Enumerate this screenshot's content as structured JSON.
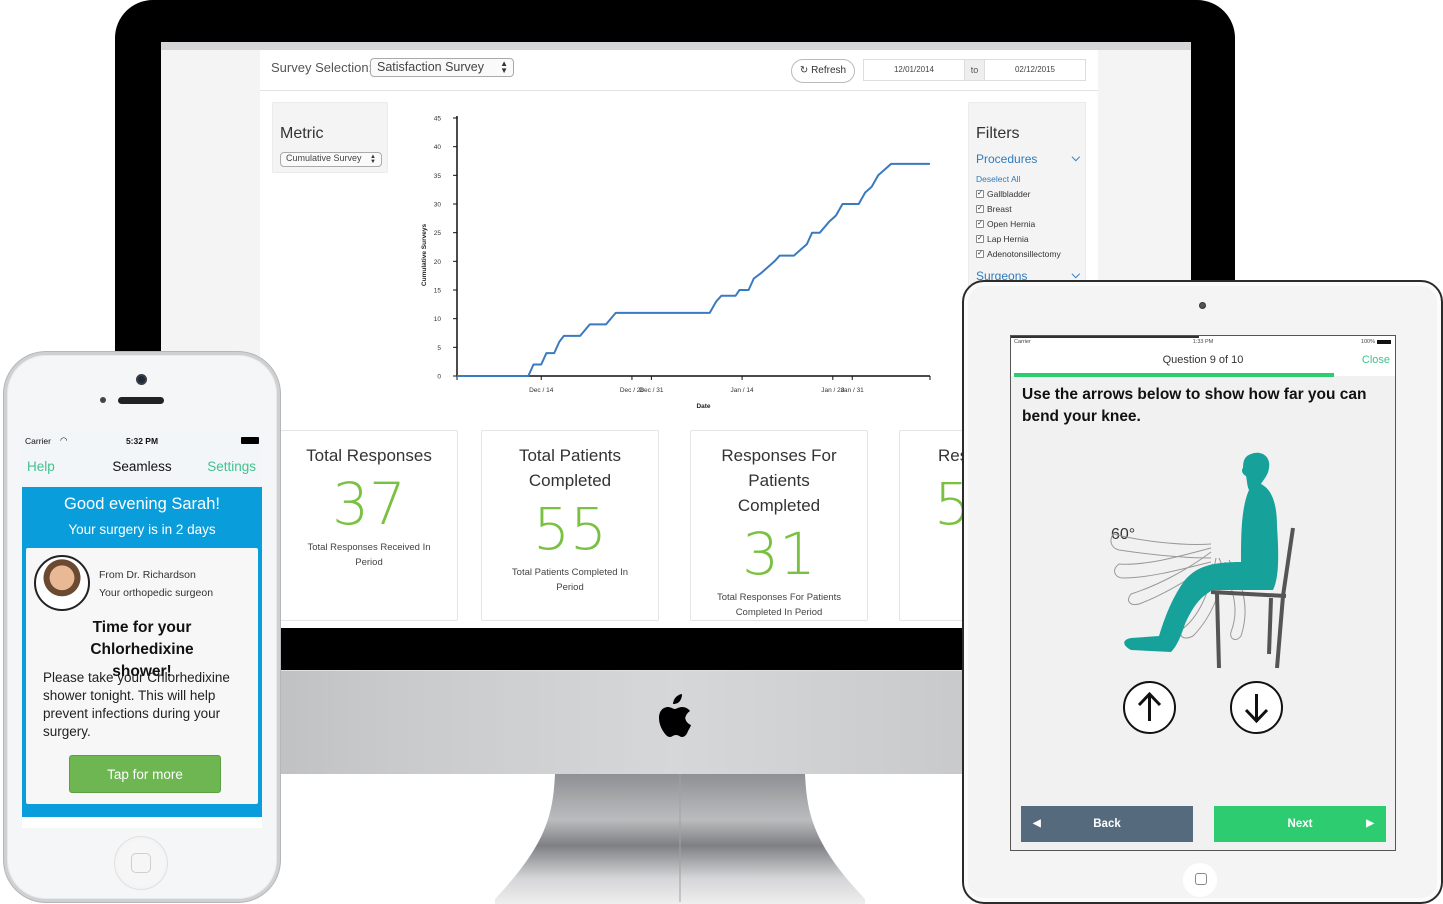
{
  "dashboard": {
    "survey_selection_label": "Survey Selection:",
    "survey_selection_value": "Satisfaction Survey",
    "refresh_label": "Refresh",
    "date_from": "12/01/2014",
    "date_to_label": "to",
    "date_to": "02/12/2015",
    "metric": {
      "title": "Metric",
      "value": "Cumulative Survey"
    },
    "filters": {
      "title": "Filters",
      "procedures_label": "Procedures",
      "deselect_all": "Deselect All",
      "procedures": [
        {
          "label": "Gallbladder",
          "checked": true
        },
        {
          "label": "Breast",
          "checked": true
        },
        {
          "label": "Open Hernia",
          "checked": true
        },
        {
          "label": "Lap Hernia",
          "checked": true
        },
        {
          "label": "Adenotonsillectomy",
          "checked": true
        }
      ],
      "surgeons_label": "Surgeons"
    },
    "cards": [
      {
        "title": "Total Responses",
        "value": "37",
        "subtitle": "Total Responses Received In Period"
      },
      {
        "title": "Total Patients Completed",
        "value": "55",
        "subtitle": "Total Patients Completed In Period"
      },
      {
        "title": "Responses For Patients Completed",
        "value": "31",
        "subtitle": "Total Responses For Patients Completed In Period"
      },
      {
        "title": "Res",
        "value": "5",
        "subtitle": ""
      }
    ],
    "accent_color": "#7ac142",
    "link_color": "#2f7bbd"
  },
  "chart_data": {
    "type": "line",
    "title": "",
    "xlabel": "Date",
    "ylabel": "Cumulative Surveys",
    "ylim": [
      0,
      45
    ],
    "yticks": [
      0,
      5,
      10,
      15,
      20,
      25,
      30,
      35,
      40,
      45
    ],
    "xlim_days": [
      0,
      73
    ],
    "xtick_labels": [
      {
        "day": 13,
        "label": "Dec / 14"
      },
      {
        "day": 27,
        "label": "Dec / 28"
      },
      {
        "day": 30,
        "label": "Dec / 31"
      },
      {
        "day": 44,
        "label": "Jan / 14"
      },
      {
        "day": 58,
        "label": "Jan / 28"
      },
      {
        "day": 61,
        "label": "Jan / 31"
      }
    ],
    "x_origin": "2014-12-01",
    "series": [
      {
        "name": "Cumulative Surveys",
        "color": "#3a7abf",
        "points": [
          [
            0,
            0
          ],
          [
            11,
            0
          ],
          [
            11.8,
            2
          ],
          [
            13,
            2
          ],
          [
            13.8,
            4
          ],
          [
            15,
            4
          ],
          [
            15.8,
            6
          ],
          [
            16.5,
            7
          ],
          [
            19,
            7
          ],
          [
            20.5,
            9
          ],
          [
            23,
            9
          ],
          [
            24.5,
            11
          ],
          [
            39,
            11
          ],
          [
            40,
            13
          ],
          [
            40.8,
            14
          ],
          [
            43,
            14
          ],
          [
            43.6,
            15
          ],
          [
            45,
            15
          ],
          [
            45.8,
            17
          ],
          [
            47,
            18
          ],
          [
            49,
            20
          ],
          [
            49.8,
            21
          ],
          [
            52,
            21
          ],
          [
            53,
            22
          ],
          [
            54,
            23
          ],
          [
            54.8,
            25
          ],
          [
            56,
            25
          ],
          [
            57.5,
            27
          ],
          [
            58.5,
            28
          ],
          [
            59.5,
            30
          ],
          [
            62,
            30
          ],
          [
            63,
            32
          ],
          [
            64,
            33
          ],
          [
            65,
            35
          ],
          [
            66,
            36
          ],
          [
            67,
            37
          ],
          [
            73,
            37
          ]
        ]
      }
    ],
    "grid": false,
    "legend": "none"
  },
  "phone": {
    "carrier": "Carrier",
    "time": "5:32 PM",
    "nav_left": "Help",
    "nav_title": "Seamless",
    "nav_right": "Settings",
    "greeting": "Good evening Sarah!",
    "surgery_countdown": "Your surgery is in 2 days",
    "from_line": "From Dr. Richardson",
    "role_line": "Your orthopedic surgeon",
    "heading": "Time for your Chlorhedixine shower!",
    "body": "Please take your Chlorhedixine shower tonight. This will help prevent infections during your surgery.",
    "button_label": "Tap for more",
    "brand_blue": "#0a9ddb",
    "button_green": "#6db651"
  },
  "tablet": {
    "carrier": "Carrier",
    "time": "1:33 PM",
    "battery": "100%",
    "question_counter": "Question 9 of 10",
    "close_label": "Close",
    "progress": 0.9,
    "question_text": "Use the arrows below  to show how far you can bend your knee.",
    "angle_label": "60°",
    "back_label": "Back",
    "next_label": "Next",
    "figure_color": "#16a29a",
    "next_color": "#2ecc71",
    "back_color": "#566a7e"
  }
}
